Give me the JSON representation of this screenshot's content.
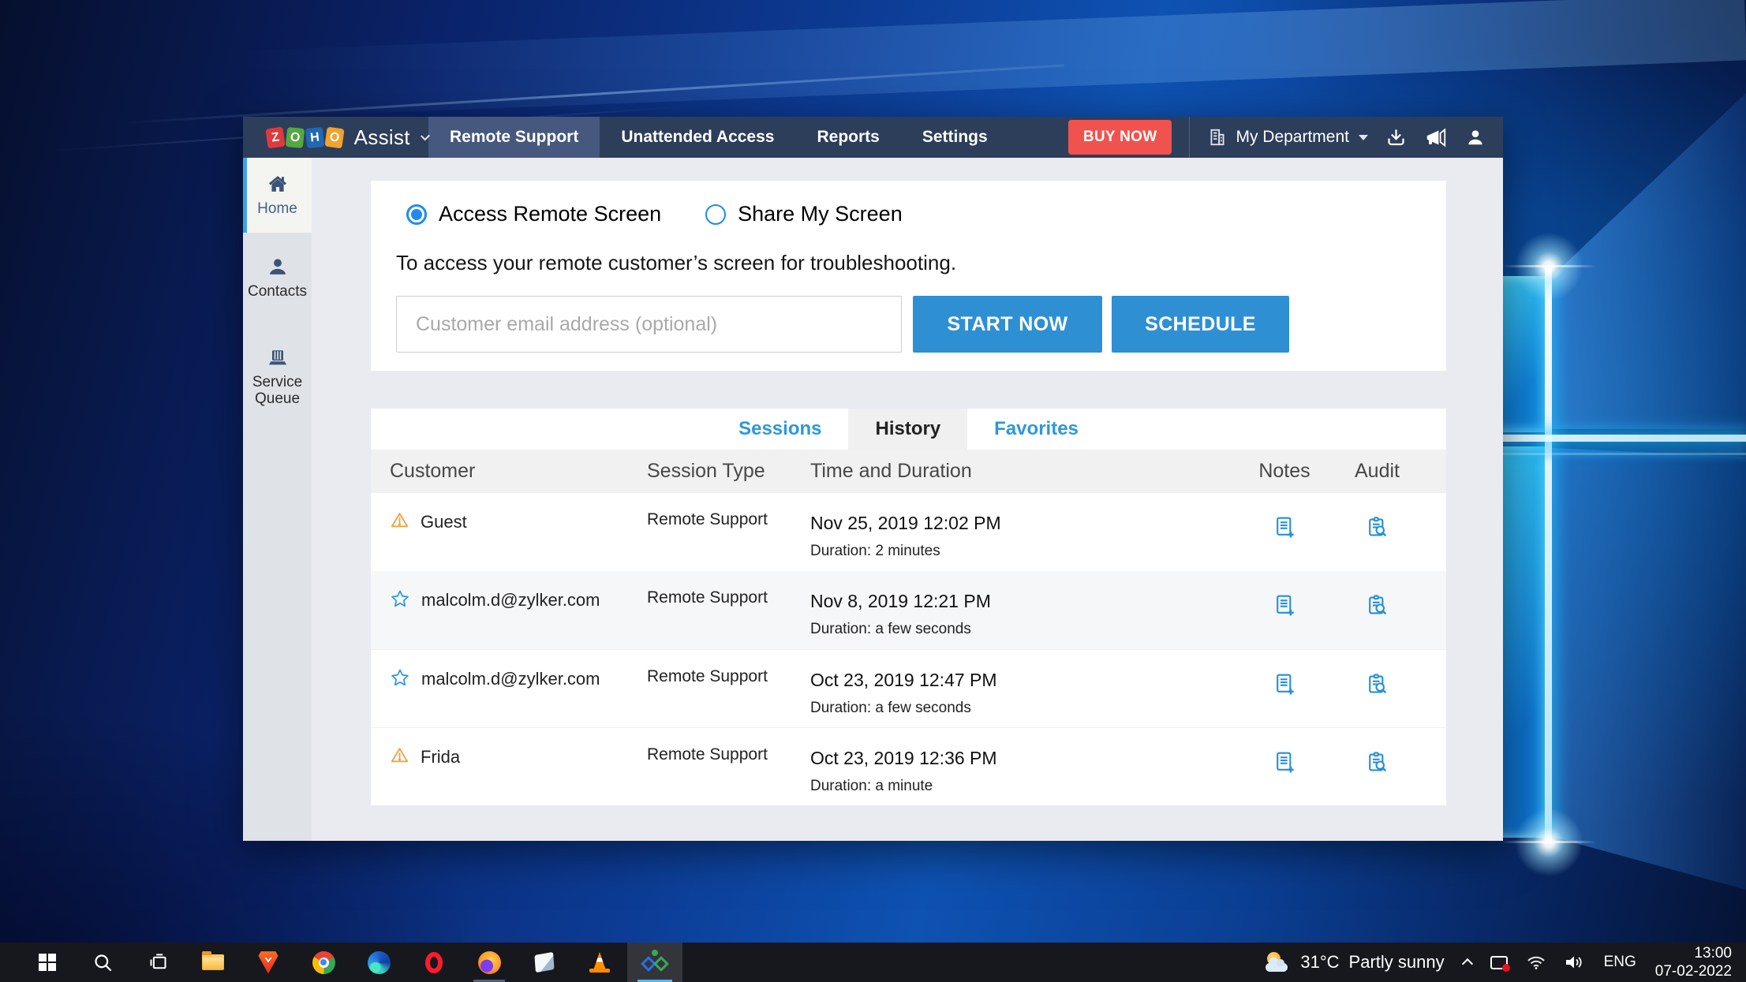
{
  "colors": {
    "nav_bg": "#2d3e5b",
    "nav_active_tab": "#46587d",
    "accent_blue": "#2e90d3",
    "link_blue": "#2b98db",
    "radio_blue": "#1f8ced",
    "buy_now_red": "#f0534e",
    "warning_orange": "#f0a13e",
    "sidebar_active_bar": "#41a1e9",
    "taskbar_bg": "#16181d"
  },
  "navbar": {
    "logo_letters": [
      "Z",
      "O",
      "H",
      "O"
    ],
    "logo_product": "Assist",
    "tabs": [
      {
        "label": "Remote Support",
        "active": true
      },
      {
        "label": "Unattended Access",
        "active": false
      },
      {
        "label": "Reports",
        "active": false
      },
      {
        "label": "Settings",
        "active": false
      }
    ],
    "buy_now_label": "BUY NOW",
    "department_label": "My Department",
    "icons": [
      "organization-icon",
      "download-icon",
      "announcement-icon",
      "user-icon"
    ]
  },
  "sidebar": {
    "items": [
      {
        "label": "Home",
        "icon": "home",
        "active": true
      },
      {
        "label": "Contacts",
        "icon": "contacts",
        "active": false
      },
      {
        "label": "Service Queue",
        "icon": "service-queue",
        "active": false
      }
    ]
  },
  "connect": {
    "radio_access": "Access Remote Screen",
    "radio_share": "Share My Screen",
    "intro": "To access your remote customer’s screen for troubleshooting.",
    "email_placeholder": "Customer email address (optional)",
    "start_label": "START NOW",
    "schedule_label": "SCHEDULE"
  },
  "sessions_panel": {
    "tabs": [
      {
        "label": "Sessions",
        "active": false
      },
      {
        "label": "History",
        "active": true
      },
      {
        "label": "Favorites",
        "active": false
      }
    ],
    "columns": [
      "Customer",
      "Session Type",
      "Time and Duration",
      "Notes",
      "Audit"
    ],
    "rows": [
      {
        "icon": "warning",
        "customer": "Guest",
        "session_type": "Remote Support",
        "time": "Nov 25, 2019 12:02 PM",
        "duration": "Duration: 2 minutes"
      },
      {
        "icon": "star",
        "customer": "malcolm.d@zylker.com",
        "session_type": "Remote Support",
        "time": "Nov 8, 2019 12:21 PM",
        "duration": "Duration: a few seconds"
      },
      {
        "icon": "star",
        "customer": "malcolm.d@zylker.com",
        "session_type": "Remote Support",
        "time": "Oct 23, 2019 12:47 PM",
        "duration": "Duration: a few seconds"
      },
      {
        "icon": "warning",
        "customer": "Frida",
        "session_type": "Remote Support",
        "time": "Oct 23, 2019 12:36 PM",
        "duration": "Duration: a minute"
      }
    ],
    "row_action_icons": [
      "add-note-icon",
      "view-audit-icon"
    ]
  },
  "taskbar": {
    "icons": [
      "start",
      "search",
      "task-view",
      "file-explorer",
      "brave",
      "chrome",
      "edge",
      "opera",
      "firefox",
      "sticky-notes",
      "vlc",
      "zoho-assist"
    ],
    "active_icon": "zoho-assist",
    "weather": {
      "temp": "31°C",
      "condition": "Partly sunny"
    },
    "tray": {
      "language": "ENG",
      "time": "13:00",
      "date": "07-02-2022"
    }
  }
}
